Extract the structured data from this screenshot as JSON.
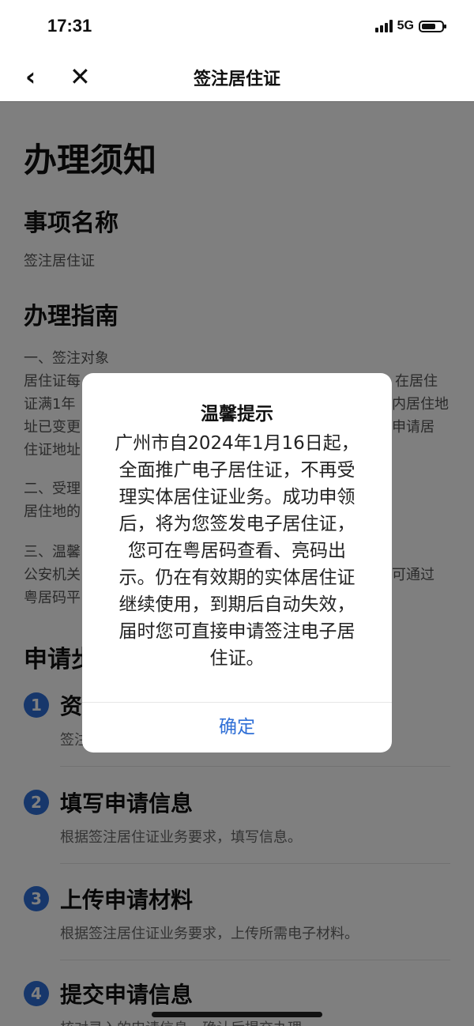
{
  "status_bar": {
    "time": "17:31",
    "network": "5G",
    "battery_level": 0.7
  },
  "nav": {
    "back_icon": "chevron-left-icon",
    "close_icon": "close-icon",
    "title": "签注居住证"
  },
  "content": {
    "heading": "办理须知",
    "item_name_heading": "事项名称",
    "item_name_value": "签注居住证",
    "guide_heading": "办理指南",
    "guide_lines": [
      "一、签注对象",
      "居住证每",
      "证满1年",
      "址已变更",
      "住证地址",
      "二、受理",
      "居住地的",
      "三、温馨",
      "公安机关",
      "粤居码平"
    ],
    "guide_right_fragments": [
      "在居住",
      "内居住地",
      "申请居",
      "可通过"
    ],
    "steps_heading": "申请步",
    "steps": [
      {
        "num": "1",
        "title": "资",
        "desc": "签注"
      },
      {
        "num": "2",
        "title": "填写申请信息",
        "desc": "根据签注居住证业务要求，填写信息。"
      },
      {
        "num": "3",
        "title": "上传申请材料",
        "desc": "根据签注居住证业务要求，上传所需电子材料。"
      },
      {
        "num": "4",
        "title": "提交申请信息",
        "desc": "核对录入的申请信息，确认后提交办理"
      }
    ]
  },
  "dialog": {
    "title": "温馨提示",
    "message_lines": [
      "广州市自2024年1月16日起，",
      "全面推广电子居住证，不再受",
      "理实体居住证业务。成功申领",
      "后，将为您签发电子居住证，",
      "您可在粤居码查看、亮码出",
      "示。仍在有效期的实体居住证",
      "继续使用，到期后自动失效，",
      "届时您可直接申请签注电子居",
      "住证。"
    ],
    "confirm_label": "确定"
  }
}
